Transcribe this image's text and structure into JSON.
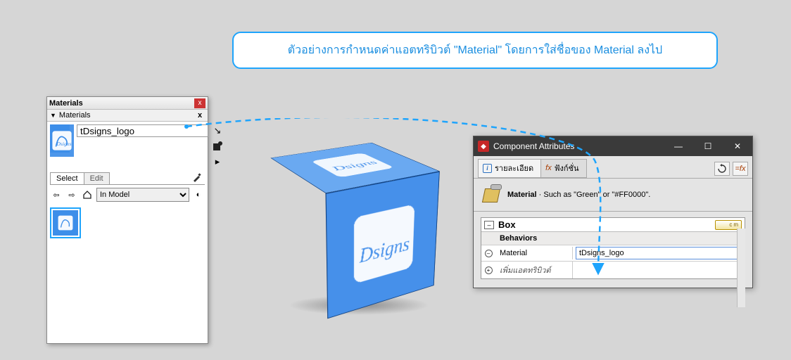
{
  "callout": {
    "text": "ตัวอย่างการกำหนดค่าแอตทริบิวต์ \"Material\" โดยการใส่ชื่อของ Material ลงไป"
  },
  "materials_panel": {
    "window_title": "Materials",
    "section_title": "Materials",
    "selected_material_name": "tDsigns_logo",
    "tabs": {
      "select": "Select",
      "edit": "Edit"
    },
    "library_dropdown": "In Model",
    "thumbnails": [
      "tDsigns_logo"
    ],
    "icons": {
      "close": "x",
      "collapse": "x",
      "dropdown_arrow": "↘",
      "create": "■",
      "more": "▸",
      "eyedrop": "eyedropper",
      "back": "⇦",
      "forward": "⇨",
      "home": "⌂",
      "details": "◐"
    }
  },
  "component_attributes": {
    "window_title": "Component Attributes",
    "tabs": {
      "details": "รายละเอียด",
      "functions": "ฟังก์ชั่น"
    },
    "description": {
      "label": "Material",
      "hint": " · Such as \"Green\" or \"#FF0000\"."
    },
    "component_name": "Box",
    "units_label": "cm",
    "section": "Behaviors",
    "rows": {
      "material": {
        "label": "Material",
        "value": "tDsigns_logo"
      },
      "add": {
        "label": "เพิ่มแอตทริบิวต์"
      }
    }
  },
  "cube": {
    "material": "tDsigns_logo"
  }
}
